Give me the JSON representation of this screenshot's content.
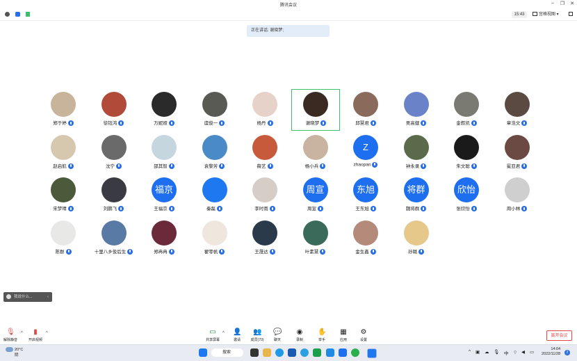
{
  "window": {
    "title": "腾讯会议"
  },
  "topbar": {
    "time": "15:43",
    "layout_label": "宫格视图"
  },
  "speaking": {
    "text": "正在讲话: 谢晓梦;"
  },
  "participants": [
    {
      "name": "郑于婷",
      "bg": "#c8b49a"
    },
    {
      "name": "徐钰鸿",
      "bg": "#b24a3a"
    },
    {
      "name": "万妮娅",
      "bg": "#2a2a2a"
    },
    {
      "name": "虞俊一",
      "bg": "#5a5a55"
    },
    {
      "name": "杨丹",
      "bg": "#e6d2c8"
    },
    {
      "name": "谢晓梦",
      "bg": "#3a2a22"
    },
    {
      "name": "邱慧君",
      "bg": "#8a6a5a"
    },
    {
      "name": "吴高健",
      "bg": "#6a82c8"
    },
    {
      "name": "金叙凯",
      "bg": "#7a7a72"
    },
    {
      "name": "章浩文",
      "bg": "#5a4a42"
    },
    {
      "name": "赵启航",
      "bg": "#d6c8ae"
    },
    {
      "name": "沈宁",
      "bg": "#6a6a6a"
    },
    {
      "name": "邵其智",
      "bg": "#c6d6de"
    },
    {
      "name": "袁黎芳",
      "bg": "#4a8ac6"
    },
    {
      "name": "薇艺",
      "bg": "#c65a3a"
    },
    {
      "name": "杨小兵",
      "bg": "#c8b4a0"
    },
    {
      "name": "zhaopan",
      "bg": "#1e6ff0",
      "text": "Z"
    },
    {
      "name": "钟永录",
      "bg": "#5a6a4a"
    },
    {
      "name": "朱文聪",
      "bg": "#1a1a1a"
    },
    {
      "name": "冕亚君",
      "bg": "#6a4a42"
    },
    {
      "name": "宋梦晴",
      "bg": "#4a5a3a"
    },
    {
      "name": "刘鹏飞",
      "bg": "#3a3a42"
    },
    {
      "name": "王福京",
      "bg": "#1e6ff0",
      "text": "福京"
    },
    {
      "name": "秦磊",
      "bg": "#1e78f0"
    },
    {
      "name": "李时雨",
      "bg": "#d6cec6"
    },
    {
      "name": "周宣",
      "bg": "#1e6ff0",
      "text": "周宣"
    },
    {
      "name": "王东旭",
      "bg": "#1e6ff0",
      "text": "东旭"
    },
    {
      "name": "魏将群",
      "bg": "#1e6ff0",
      "text": "将群"
    },
    {
      "name": "张欣怡",
      "bg": "#1e6ff0",
      "text": "欣怡"
    },
    {
      "name": "周小林",
      "bg": "#cfcfcf"
    },
    {
      "name": "陈群",
      "bg": "#e8e8e6"
    },
    {
      "name": "十里八乡俊后生",
      "bg": "#5a7aa6"
    },
    {
      "name": "郑冉冉",
      "bg": "#6a2a3a"
    },
    {
      "name": "翟零帆",
      "bg": "#efe6de"
    },
    {
      "name": "王晟达",
      "bg": "#2a3a4a"
    },
    {
      "name": "叶素慧",
      "bg": "#3a6a5a"
    },
    {
      "name": "金生鑫",
      "bg": "#b48a7a"
    },
    {
      "name": "孙璐",
      "bg": "#e6c88a"
    }
  ],
  "chat_placeholder": "我说什么...",
  "toolbar": {
    "mute": "解除静音",
    "video": "开启视频",
    "share": "共享屏幕",
    "invite": "邀请",
    "members": "成员(70)",
    "chat": "聊天",
    "record": "录制",
    "raise": "举手",
    "apps": "应用",
    "settings": "设置",
    "leave": "离开会议"
  },
  "taskbar": {
    "weather_temp": "20°C",
    "weather_desc": "阴",
    "search": "搜索",
    "ime": "中",
    "time": "14:04",
    "date": "2022/11/28",
    "notifications": "2"
  },
  "colors": {
    "accent": "#2a6ee6",
    "active_border": "#3cbf6a",
    "leave": "#e04848"
  }
}
